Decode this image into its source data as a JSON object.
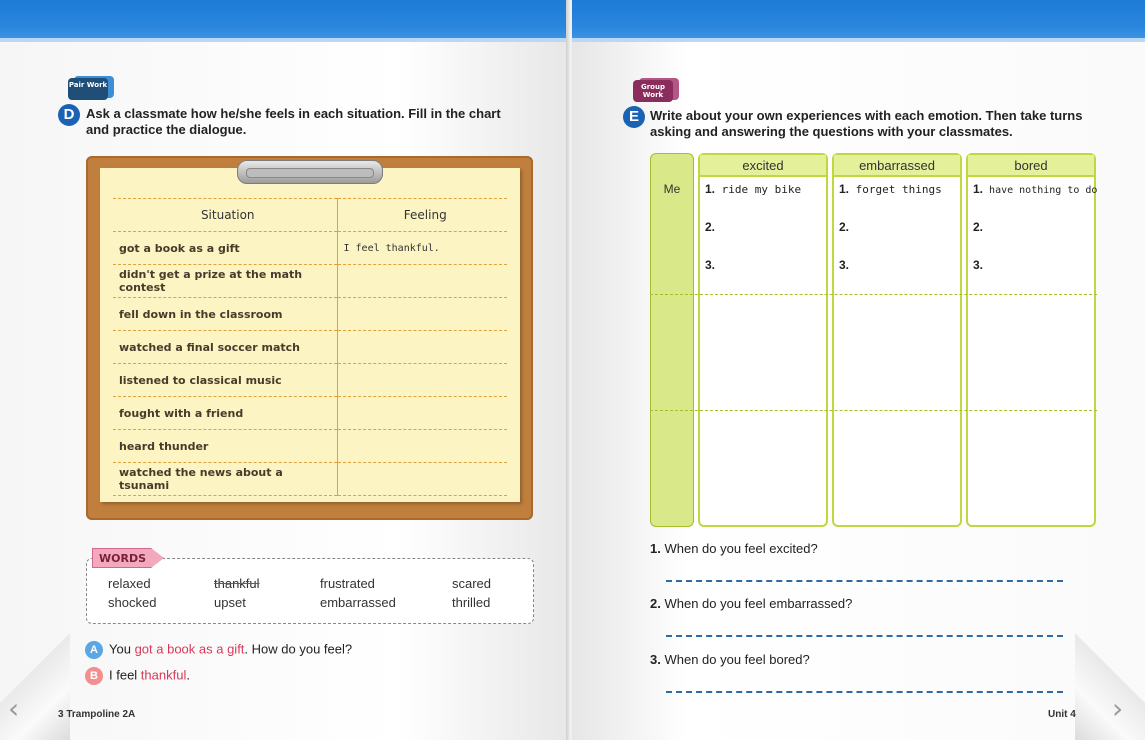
{
  "left_page": {
    "badge": "Pair Work",
    "activity_letter": "D",
    "instruction": "Ask a classmate how he/she feels in each situation. Fill in the chart and practice the dialogue.",
    "chart": {
      "headers": [
        "Situation",
        "Feeling"
      ],
      "rows": [
        {
          "situation": "got a book as a gift",
          "feeling": "I feel thankful."
        },
        {
          "situation": "didn't get a prize at the math contest",
          "feeling": ""
        },
        {
          "situation": "fell down in the classroom",
          "feeling": ""
        },
        {
          "situation": "watched a final soccer match",
          "feeling": ""
        },
        {
          "situation": "listened to classical music",
          "feeling": ""
        },
        {
          "situation": "fought with a friend",
          "feeling": ""
        },
        {
          "situation": "heard thunder",
          "feeling": ""
        },
        {
          "situation": "watched the news about a tsunami",
          "feeling": ""
        }
      ]
    },
    "words": {
      "title": "WORDS",
      "items": [
        "relaxed",
        "thankful",
        "frustrated",
        "scared",
        "shocked",
        "upset",
        "embarrassed",
        "thrilled"
      ]
    },
    "dialogue": {
      "a_badge": "A",
      "a_pre": "You ",
      "a_highlight": "got a book as a gift",
      "a_post": ". How do you feel?",
      "b_badge": "B",
      "b_pre": "I feel ",
      "b_highlight": "thankful",
      "b_post": "."
    },
    "footer": "Trampoline 2A",
    "page_number": "3"
  },
  "right_page": {
    "badge": "Group Work",
    "activity_letter": "E",
    "instruction": "Write about your own experiences with each emotion. Then take turns asking and answering the questions with your classmates.",
    "row_label": "Me",
    "columns": [
      {
        "header": "excited",
        "entries": [
          "ride my bike",
          "",
          ""
        ]
      },
      {
        "header": "embarrassed",
        "entries": [
          "forget things",
          "",
          ""
        ]
      },
      {
        "header": "bored",
        "entries": [
          "have nothing to do",
          "",
          ""
        ]
      }
    ],
    "entry_numbers": [
      "1.",
      "2.",
      "3."
    ],
    "questions": [
      {
        "num": "1.",
        "text": "When do you feel excited?"
      },
      {
        "num": "2.",
        "text": "When do you feel embarrassed?"
      },
      {
        "num": "3.",
        "text": "When do you feel bored?"
      }
    ],
    "footer": "Unit 4"
  },
  "colors": {
    "top_band": "#1d7ad6",
    "highlight": "#d43a58",
    "clipboard": "#c07f3c",
    "note": "#fdf4c4",
    "chart_green": "#c2d63f",
    "a_badge": "#5aa7e6",
    "b_badge": "#f28f8f"
  }
}
